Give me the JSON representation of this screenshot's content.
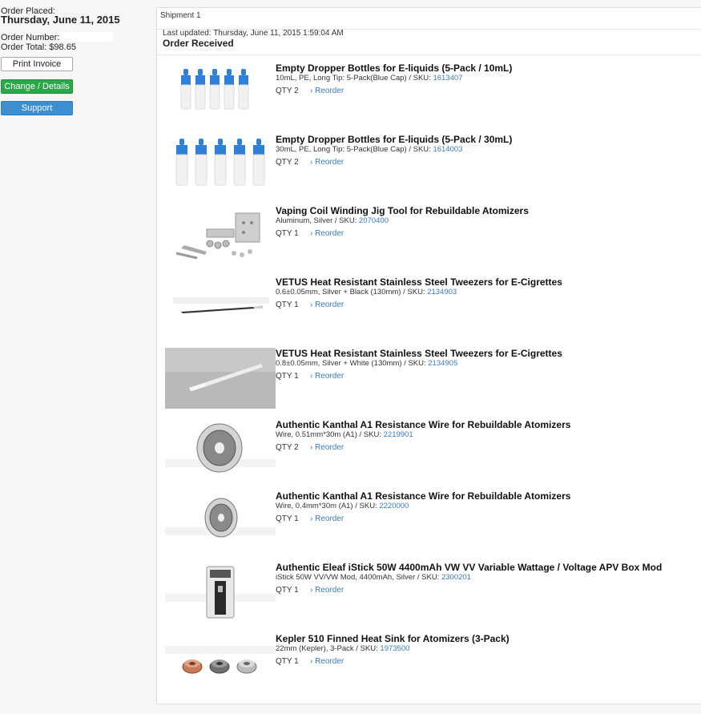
{
  "order": {
    "placed_label": "Order Placed:",
    "placed_date": "Thursday, June 11, 2015",
    "number_label": "Order Number:",
    "total_label": "Order Total: $98.65"
  },
  "buttons": {
    "print": "Print Invoice",
    "change": "Change / Details",
    "support": "Support"
  },
  "shipment": {
    "title": "Shipment 1",
    "updated": "Last updated: Thursday, June 11, 2015 1:59:04 AM",
    "status": "Order Received"
  },
  "reorder_label": "› Reorder",
  "items": [
    {
      "title": "Empty Dropper Bottles for E-liquids (5-Pack / 10mL)",
      "desc": "10mL, PE, Long Tip: 5-Pack(Blue Cap) / SKU: ",
      "sku": "1613407",
      "qty": "QTY 2",
      "image": "dropper-bottles-icon"
    },
    {
      "title": "Empty Dropper Bottles for E-liquids (5-Pack / 30mL)",
      "desc": "30mL, PE, Long Tip: 5-Pack(Blue Cap) / SKU: ",
      "sku": "1614003",
      "qty": "QTY 2",
      "image": "dropper-bottles-icon"
    },
    {
      "title": "Vaping Coil Winding Jig Tool for Rebuildable Atomizers",
      "desc": "Aluminum, Silver / SKU: ",
      "sku": "2070400",
      "qty": "QTY 1",
      "image": "coil-jig-icon"
    },
    {
      "title": "VETUS Heat Resistant Stainless Steel Tweezers for E-Cigrettes",
      "desc": "0.6±0.05mm, Silver + Black (130mm) / SKU: ",
      "sku": "2134903",
      "qty": "QTY 1",
      "image": "tweezers-icon"
    },
    {
      "title": "VETUS Heat Resistant Stainless Steel Tweezers for E-Cigrettes",
      "desc": "0.8±0.05mm, Silver + White (130mm) / SKU: ",
      "sku": "2134905",
      "qty": "QTY 1",
      "image": "tweezers-photo-icon"
    },
    {
      "title": "Authentic Kanthal A1 Resistance Wire for Rebuildable Atomizers",
      "desc": "Wire, 0.51mm*30m (A1) / SKU: ",
      "sku": "2219901",
      "qty": "QTY 2",
      "image": "wire-spool-icon"
    },
    {
      "title": "Authentic Kanthal A1 Resistance Wire for Rebuildable Atomizers",
      "desc": "Wire, 0.4mm*30m (A1) / SKU: ",
      "sku": "2220000",
      "qty": "QTY 1",
      "image": "wire-spool-icon"
    },
    {
      "title": "Authentic Eleaf iStick 50W 4400mAh VW VV Variable Wattage / Voltage APV Box Mod",
      "desc": "iStick 50W VV/VW Mod, 4400mAh, Silver / SKU: ",
      "sku": "2300201",
      "qty": "QTY 1",
      "image": "box-mod-icon"
    },
    {
      "title": "Kepler 510 Finned Heat Sink for Atomizers (3-Pack)",
      "desc": "22mm (Kepler), 3-Pack / SKU: ",
      "sku": "1973500",
      "qty": "QTY 1",
      "image": "heat-sink-icon"
    }
  ]
}
